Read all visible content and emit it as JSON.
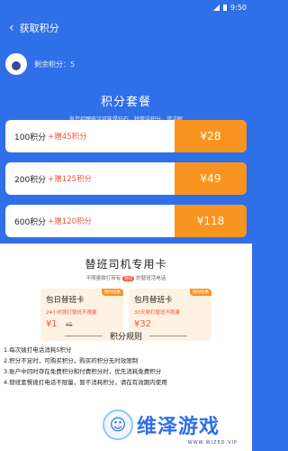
{
  "statusbar": {
    "time": "9:50"
  },
  "header": {
    "back_icon": "back-icon",
    "title": "获取积分"
  },
  "user": {
    "points_label": "剩余积分：5"
  },
  "packages_section": {
    "title": "积分套餐",
    "subtitle": "有您招聘电话可能是钻石，特赠送积分，请详解",
    "items": [
      {
        "points": "100积分",
        "gift": "+赠45积分",
        "price": "¥28"
      },
      {
        "points": "200积分",
        "gift": "+赠125积分",
        "price": "¥49"
      },
      {
        "points": "600积分",
        "gift": "+赠120积分",
        "price": "¥118"
      }
    ]
  },
  "driver_card": {
    "title": "替班司机专用卡",
    "subtitle_prefix": "不限量拨打带有",
    "subtitle_tag": "替班",
    "subtitle_suffix": "的替班活电话",
    "cards": [
      {
        "name": "包日替班卡",
        "badge": "限时优惠",
        "desc": "24小时拨打替班不限量",
        "price": "¥1",
        "old_price": "¥5"
      },
      {
        "name": "包月替班卡",
        "badge": "限时优惠",
        "desc": "30天拨打替班不限量",
        "price": "¥32",
        "old_price": ""
      }
    ]
  },
  "rules": {
    "title": "积分规则",
    "items": [
      "1.每次拨打电话消耗5积分",
      "2.积分不足时，可购买积分，购买的积分无时效限制",
      "3.账户中同时存在免费积分和付费积分时，优先消耗免费积分",
      "4.替班套餐拨打电话不限量，暂不消耗积分，请在有效期内使用"
    ]
  },
  "watermark": {
    "text": "维泽游戏",
    "sub": "WWW.WIZED.VIP"
  },
  "colors": {
    "primary": "#2f6fe8",
    "orange": "#fa9420",
    "red": "#f2553a",
    "card_bg": "#fff2e3"
  }
}
